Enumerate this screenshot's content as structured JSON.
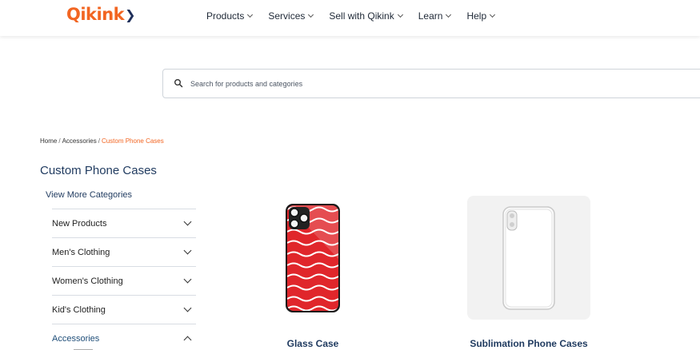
{
  "header": {
    "logo_text": "Qikink",
    "nav": [
      {
        "label": "Products"
      },
      {
        "label": "Services"
      },
      {
        "label": "Sell with Qikink"
      },
      {
        "label": "Learn"
      },
      {
        "label": "Help"
      }
    ]
  },
  "search": {
    "placeholder": "Search for products and categories",
    "value": ""
  },
  "breadcrumb": {
    "items": [
      "Home",
      "Accessories"
    ],
    "current": "Custom Phone Cases",
    "separator": "/"
  },
  "page_title": "Custom Phone Cases",
  "view_more_label": "View More Categories",
  "categories": [
    {
      "label": "New Products",
      "expanded": false
    },
    {
      "label": "Men's Clothing",
      "expanded": false
    },
    {
      "label": "Women's Clothing",
      "expanded": false
    },
    {
      "label": "Kid's Clothing",
      "expanded": false
    },
    {
      "label": "Accessories",
      "expanded": true
    }
  ],
  "products": [
    {
      "name": "Glass Case",
      "image": "red-wave-glass-phone-case"
    },
    {
      "name": "Sublimation Phone Cases",
      "image": "white-sublimation-phone-case"
    }
  ],
  "colors": {
    "brand": "#f26522",
    "navy": "#1f3a5f",
    "case_red": "#e0262b"
  }
}
